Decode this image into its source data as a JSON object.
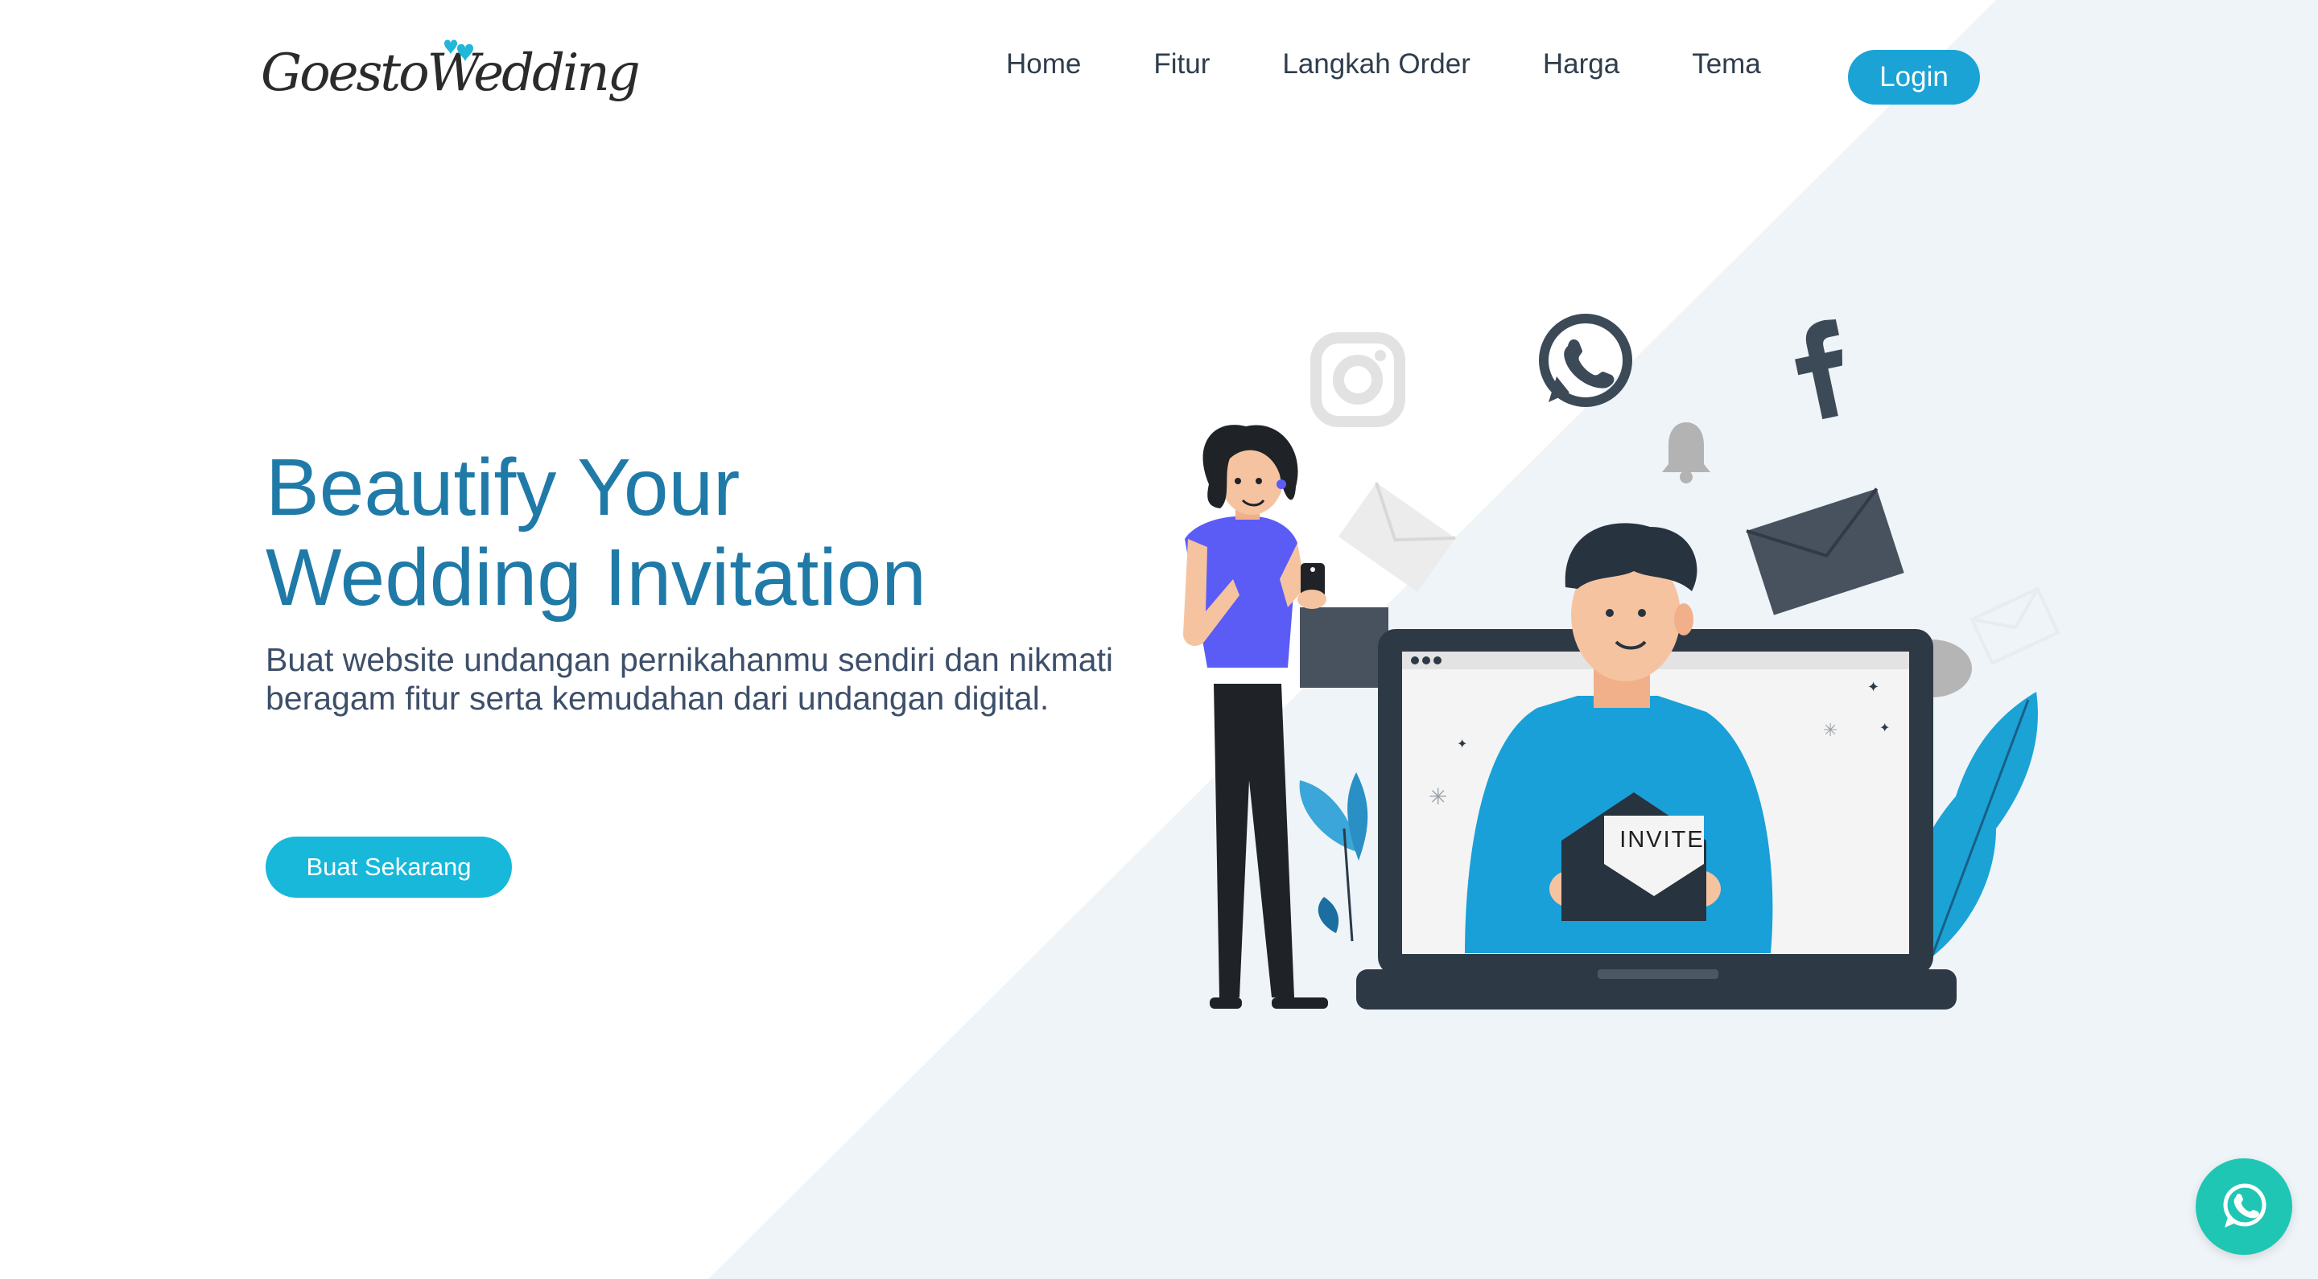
{
  "brand": {
    "logo_text": "GoestoWedding",
    "accent_color": "#1ba3d6",
    "title_color": "#1f7aa8"
  },
  "nav": {
    "items": [
      {
        "label": "Home"
      },
      {
        "label": "Fitur"
      },
      {
        "label": "Langkah Order"
      },
      {
        "label": "Harga"
      },
      {
        "label": "Tema"
      }
    ],
    "login_label": "Login"
  },
  "hero": {
    "title_line1": "Beautify Your",
    "title_line2": "Wedding Invitation",
    "subtitle": "Buat website undangan pernikahanmu sendiri dan nikmati beragam fitur serta kemudahan dari undangan digital.",
    "cta_label": "Buat Sekarang"
  },
  "illustration": {
    "envelope_text": "INVITE",
    "icons": [
      "instagram-icon",
      "whatsapp-icon",
      "facebook-icon",
      "bell-icon",
      "envelope-icon",
      "chat-bubble-icon"
    ]
  },
  "floating": {
    "icon": "whatsapp-icon",
    "color": "#1fc6b4"
  }
}
